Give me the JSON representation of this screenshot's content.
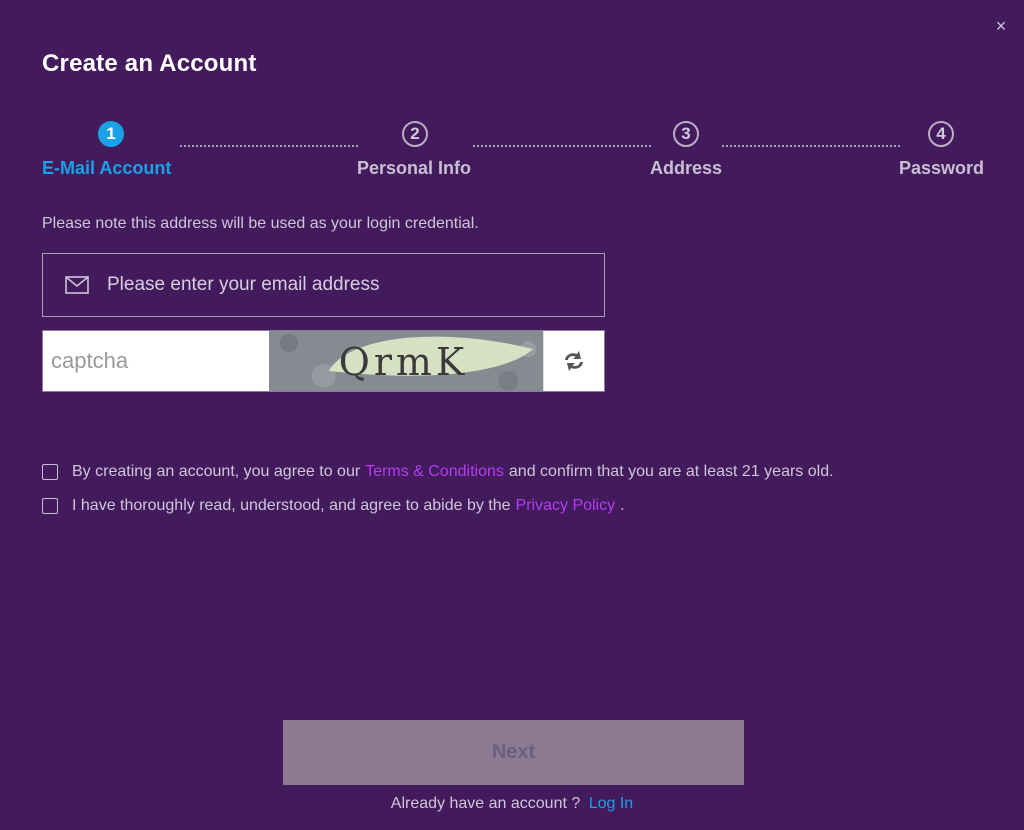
{
  "dialog": {
    "title": "Create an Account",
    "close_glyph": "×"
  },
  "stepper": {
    "steps": [
      {
        "number": "1",
        "label": "E-Mail Account",
        "active": true
      },
      {
        "number": "2",
        "label": "Personal Info",
        "active": false
      },
      {
        "number": "3",
        "label": "Address",
        "active": false
      },
      {
        "number": "4",
        "label": "Password",
        "active": false
      }
    ]
  },
  "form": {
    "note": "Please note this address will be used as your login credential.",
    "email": {
      "placeholder": "Please enter your email address",
      "value": "",
      "icon": "mail-icon"
    },
    "captcha": {
      "placeholder": "captcha",
      "value": "",
      "image_text": "QrmK",
      "refresh_icon": "refresh-icon"
    }
  },
  "agreements": {
    "terms": {
      "before": "By creating an account, you agree to our",
      "link": "Terms & Conditions",
      "after": "and confirm that you are at least 21 years old."
    },
    "privacy": {
      "before": "I have thoroughly read, understood, and agree to abide by the",
      "link": "Privacy Policy",
      "after": "."
    }
  },
  "footer": {
    "next_label": "Next",
    "login_prompt": "Already have an account ?",
    "login_link": "Log In"
  },
  "colors": {
    "background": "#431b5d",
    "accent_blue": "#1aa0e6",
    "link_purple": "#b13cf0",
    "next_disabled": "#8b7a91"
  }
}
